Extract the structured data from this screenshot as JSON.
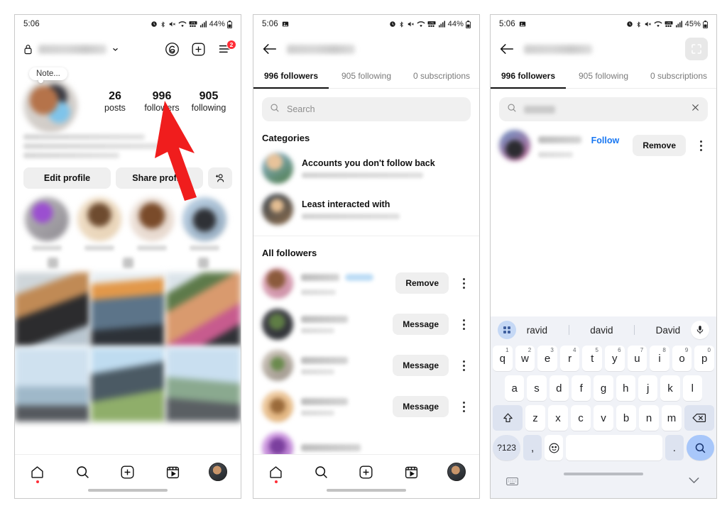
{
  "meta": {
    "app": "Instagram",
    "accent_blue": "#1877F2",
    "badge_red": "#FF2D37",
    "key_accent": "#A8C7FA"
  },
  "panel1": {
    "status": {
      "time": "5:06",
      "battery": "44%",
      "icons": [
        "alarm-icon",
        "bluetooth-icon",
        "mute-icon",
        "wifi-icon",
        "lte-icon",
        "signal-icon",
        "battery-icon"
      ]
    },
    "header": {
      "lock_icon": "lock-icon",
      "username_blurred": true,
      "threads_icon": "threads-icon",
      "create_icon": "plus-square-icon",
      "menu_icon": "hamburger-icon",
      "menu_badge": "2"
    },
    "note": {
      "label": "Note..."
    },
    "stats": [
      {
        "number": "26",
        "label": "posts"
      },
      {
        "number": "996",
        "label": "followers"
      },
      {
        "number": "905",
        "label": "following"
      }
    ],
    "buttons": {
      "edit": "Edit profile",
      "share": "Share profile",
      "add_person_icon": "add-person-icon"
    },
    "bottom_nav": [
      "home-icon",
      "search-icon",
      "plus-square-icon",
      "reels-icon",
      "profile-avatar"
    ]
  },
  "panel2": {
    "status": {
      "time": "5:06",
      "battery": "44%"
    },
    "header": {
      "back_icon": "back-arrow-icon",
      "title_blurred": true
    },
    "tabs": [
      {
        "label": "996 followers",
        "active": true
      },
      {
        "label": "905 following",
        "active": false
      },
      {
        "label": "0 subscriptions",
        "active": false
      }
    ],
    "search": {
      "placeholder": "Search",
      "icon": "search-icon"
    },
    "sections": {
      "categories_title": "Categories",
      "categories": [
        {
          "name": "Accounts you don't follow back",
          "sub_blurred": true
        },
        {
          "name": "Least interacted with",
          "sub_blurred": true
        }
      ],
      "all_title": "All followers",
      "followers": [
        {
          "action": "Remove",
          "has_tag": true
        },
        {
          "action": "Message",
          "has_tag": false
        },
        {
          "action": "Message",
          "has_tag": false
        },
        {
          "action": "Message",
          "has_tag": false
        }
      ]
    },
    "bottom_nav": [
      "home-icon",
      "search-icon",
      "plus-square-icon",
      "reels-icon",
      "profile-avatar"
    ]
  },
  "panel3": {
    "status": {
      "time": "5:06",
      "battery": "45%"
    },
    "header": {
      "back_icon": "back-arrow-icon",
      "title_blurred": true,
      "fullscreen_icon": "fullscreen-icon"
    },
    "tabs": [
      {
        "label": "996 followers",
        "active": true
      },
      {
        "label": "905 following",
        "active": false
      },
      {
        "label": "0 subscriptions",
        "active": false
      }
    ],
    "search": {
      "value_blurred": true,
      "clear_icon": "close-icon",
      "icon": "search-icon"
    },
    "result": {
      "follow_label": "Follow",
      "action": "Remove",
      "kebab_icon": "more-vertical-icon"
    },
    "keyboard": {
      "suggestions": [
        "ravid",
        "david",
        "David"
      ],
      "grid_icon": "keyboard-grid-icon",
      "mic_icon": "microphone-icon",
      "row1": [
        {
          "k": "q",
          "n": "1"
        },
        {
          "k": "w",
          "n": "2"
        },
        {
          "k": "e",
          "n": "3"
        },
        {
          "k": "r",
          "n": "4"
        },
        {
          "k": "t",
          "n": "5"
        },
        {
          "k": "y",
          "n": "6"
        },
        {
          "k": "u",
          "n": "7"
        },
        {
          "k": "i",
          "n": "8"
        },
        {
          "k": "o",
          "n": "9"
        },
        {
          "k": "p",
          "n": "0"
        }
      ],
      "row2": [
        "a",
        "s",
        "d",
        "f",
        "g",
        "h",
        "j",
        "k",
        "l"
      ],
      "row3": [
        "z",
        "x",
        "c",
        "v",
        "b",
        "n",
        "m"
      ],
      "shift_icon": "shift-icon",
      "backspace_icon": "backspace-icon",
      "numbers_key": "?123",
      "comma_key": ",",
      "emoji_icon": "emoji-icon",
      "space_key": "",
      "period_key": ".",
      "search_key_icon": "search-icon",
      "switcher_icon": "keyboard-switch-icon",
      "hide_icon": "chevron-down-icon"
    }
  },
  "annotation": {
    "arrow": "red-arrow-pointing-to-followers"
  }
}
